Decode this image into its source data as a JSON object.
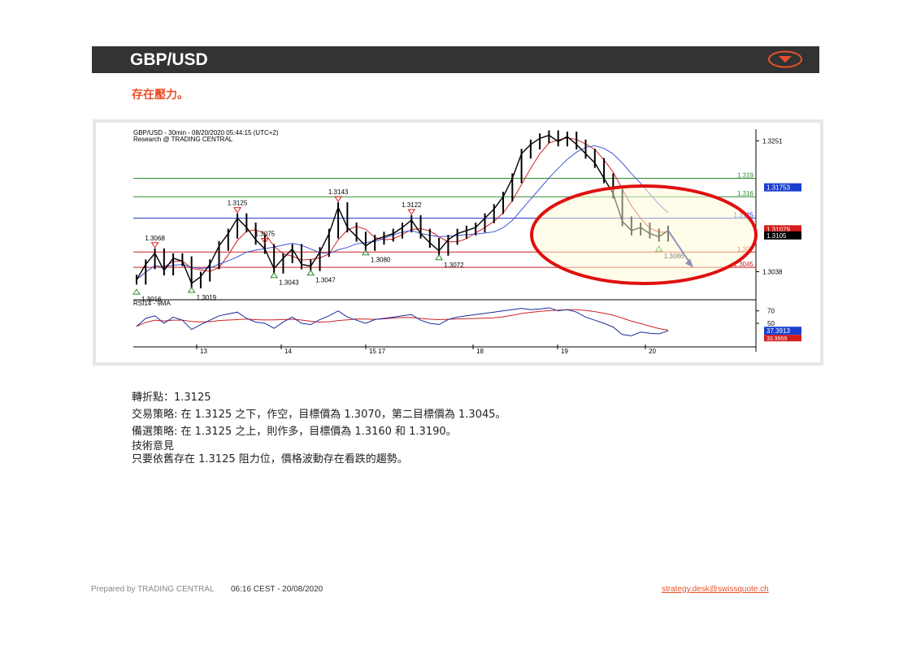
{
  "header": {
    "title": "GBP/USD",
    "accent": "#e8502a"
  },
  "subtitle": "存在壓力。",
  "chart_data": {
    "type": "line",
    "title": "GBP/USD - 30min - 08/20/2020 05:44:15 (UTC+2)",
    "subtitle": "Research @ TRADING CENTRAL",
    "y_range": [
      1.2995,
      1.327
    ],
    "price_axis_ticks": [
      "1.3251",
      "1.3038"
    ],
    "x_tick_labels": [
      "13",
      "14",
      "15 17",
      "18",
      "19",
      "20"
    ],
    "price_series": {
      "name": "GBP/USD",
      "close": [
        1.3025,
        1.305,
        1.3068,
        1.304,
        1.306,
        1.3055,
        1.3019,
        1.303,
        1.305,
        1.308,
        1.31,
        1.3125,
        1.311,
        1.309,
        1.3075,
        1.3043,
        1.306,
        1.3075,
        1.305,
        1.3047,
        1.307,
        1.31,
        1.3143,
        1.311,
        1.3095,
        1.308,
        1.309,
        1.3095,
        1.31,
        1.311,
        1.3122,
        1.31,
        1.3085,
        1.3072,
        1.309,
        1.31,
        1.3105,
        1.311,
        1.3125,
        1.314,
        1.316,
        1.319,
        1.323,
        1.3245,
        1.3255,
        1.326,
        1.325,
        1.3258,
        1.3245,
        1.323,
        1.3215,
        1.319,
        1.3165,
        1.312,
        1.3105,
        1.311,
        1.31,
        1.3095,
        1.3105
      ],
      "color": "#000000"
    },
    "projection": {
      "from": 1.3105,
      "to": 1.305,
      "color": "#1a2a9a"
    },
    "horizontal_levels": [
      {
        "value": 1.319,
        "label": "1.319",
        "color": "#2e8b2e"
      },
      {
        "value": 1.316,
        "label": "1.316",
        "color": "#2e8b2e"
      },
      {
        "value": 1.3125,
        "label": "1.3125",
        "color": "#2233cc"
      },
      {
        "value": 1.307,
        "label": "1.307",
        "color": "#cc2222"
      },
      {
        "value": 1.3045,
        "label": "1.3045",
        "color": "#cc2222"
      }
    ],
    "price_tags": [
      {
        "value": 1.31753,
        "label": "1.31753",
        "bg": "#1a3fcf"
      },
      {
        "value": 1.3107,
        "label": "1.31079",
        "bg": "#d41c1c"
      },
      {
        "value": 1.3105,
        "label": "1.3105",
        "bg": "#000000"
      }
    ],
    "swing_highs": [
      {
        "label": "1.3068",
        "value": 1.3068,
        "i": 2
      },
      {
        "label": "1.3125",
        "value": 1.3125,
        "i": 11
      },
      {
        "label": "1.3075",
        "value": 1.3075,
        "i": 14
      },
      {
        "label": "1.3143",
        "value": 1.3143,
        "i": 22
      },
      {
        "label": "1.3122",
        "value": 1.3122,
        "i": 30
      }
    ],
    "swing_lows": [
      {
        "label": "1.3019",
        "value": 1.3019,
        "i": 6
      },
      {
        "label": "1.3043",
        "value": 1.3043,
        "i": 15
      },
      {
        "label": "1.3047",
        "value": 1.3047,
        "i": 19
      },
      {
        "label": "1.3080",
        "value": 1.308,
        "i": 25
      },
      {
        "label": "1.3072",
        "value": 1.3072,
        "i": 33
      },
      {
        "label": "1.3086",
        "value": 1.3086,
        "i": 57
      },
      {
        "label": "1.3016",
        "value": 1.3016,
        "i": 0
      }
    ],
    "rsi": {
      "label": "RSI14 - 9MA",
      "ticks": [
        "70",
        "50"
      ],
      "values": [
        45,
        58,
        62,
        50,
        60,
        55,
        40,
        48,
        55,
        62,
        65,
        68,
        58,
        52,
        50,
        42,
        52,
        60,
        50,
        48,
        56,
        62,
        70,
        60,
        55,
        50,
        56,
        58,
        60,
        62,
        64,
        55,
        50,
        48,
        56,
        60,
        62,
        64,
        66,
        68,
        70,
        72,
        74,
        72,
        73,
        75,
        70,
        72,
        68,
        60,
        55,
        50,
        44,
        32,
        30,
        36,
        34,
        33,
        38
      ],
      "last_label": "37.3913",
      "ma_label": "33.9959",
      "color": "#1a2a9a",
      "ma_color": "#cc2222"
    }
  },
  "notes": {
    "pivot": "轉折點：1.3125",
    "strategy": "交易策略: 在 1.3125 之下，作空，目標價為 1.3070，第二目標價為 1.3045。",
    "alternative": "備選策略: 在 1.3125 之上，則作多，目標價為 1.3160 和 1.3190。",
    "commentary_title": "技術意見",
    "commentary": "只要依舊存在 1.3125 阻力位，價格波動存在看跌的趨勢。"
  },
  "footer": {
    "prepared": "Prepared by TRADING CENTRAL",
    "time": "06:16 CEST - 20/08/2020",
    "email": "strategy.desk@swissquote.ch"
  }
}
